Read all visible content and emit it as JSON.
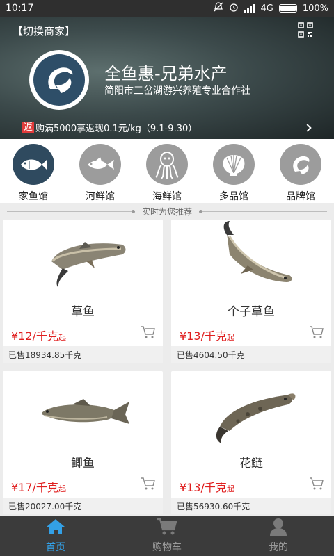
{
  "status_bar": {
    "time": "10:17",
    "network": "4G",
    "battery": "100%"
  },
  "header": {
    "switch_merchant": "【切换商家】",
    "shop_name": "全鱼惠-兄弟水产",
    "shop_subtitle": "简阳市三岔湖游兴养殖专业合作社",
    "promo_tag": "返",
    "promo_text": "购满5000享返现0.1元/kg（9.1-9.30）"
  },
  "categories": [
    {
      "label": "家鱼馆",
      "icon": "fish-icon"
    },
    {
      "label": "河鲜馆",
      "icon": "fish-icon"
    },
    {
      "label": "海鲜馆",
      "icon": "octopus-icon"
    },
    {
      "label": "多品馆",
      "icon": "shell-icon"
    },
    {
      "label": "品牌馆",
      "icon": "brand-icon"
    }
  ],
  "recommend_title": "实时为您推荐",
  "products": [
    {
      "name": "草鱼",
      "price": "¥12/千克",
      "price_suffix": "起",
      "sold": "已售18934.85千克"
    },
    {
      "name": "个子草鱼",
      "price": "¥13/千克",
      "price_suffix": "起",
      "sold": "已售4604.50千克"
    },
    {
      "name": "鲫鱼",
      "price": "¥17/千克",
      "price_suffix": "起",
      "sold": "已售20027.00千克"
    },
    {
      "name": "花鲢",
      "price": "¥13/千克",
      "price_suffix": "起",
      "sold": "已售56930.60千克"
    }
  ],
  "nav": [
    {
      "label": "首页",
      "icon": "home-icon",
      "active": true
    },
    {
      "label": "购物车",
      "icon": "cart-icon",
      "active": false
    },
    {
      "label": "我的",
      "icon": "user-icon",
      "active": false
    }
  ],
  "colors": {
    "price_red": "#e02020",
    "nav_active": "#33a0e6",
    "category_active": "#2f4a5f"
  }
}
